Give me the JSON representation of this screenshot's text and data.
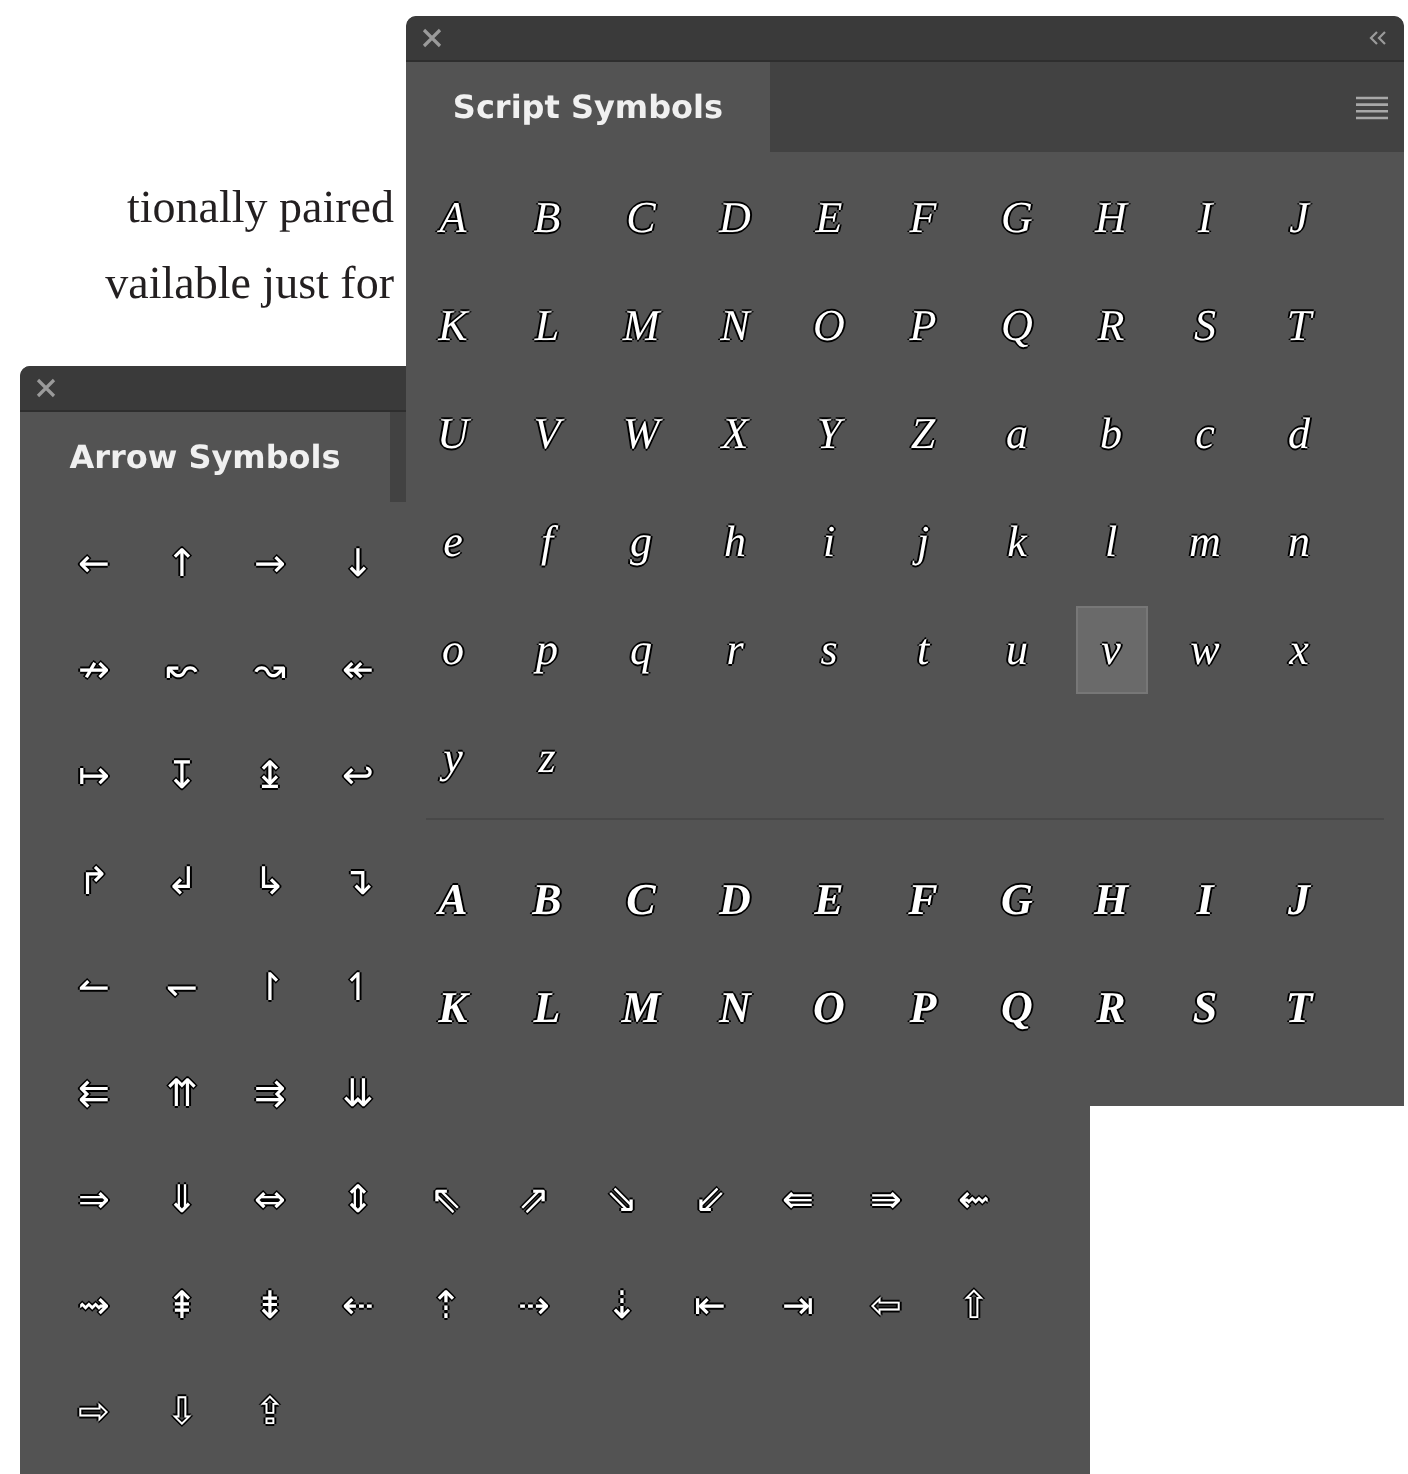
{
  "page_text": [
    "tionally paired",
    "vailable just for"
  ],
  "script_panel": {
    "title": "Script Symbols",
    "sets": [
      {
        "kind": "regular",
        "glyphs": [
          {
            "char": "A",
            "selected": false
          },
          {
            "char": "B",
            "selected": false
          },
          {
            "char": "C",
            "selected": false
          },
          {
            "char": "D",
            "selected": false
          },
          {
            "char": "E",
            "selected": false
          },
          {
            "char": "F",
            "selected": false
          },
          {
            "char": "G",
            "selected": false
          },
          {
            "char": "H",
            "selected": false
          },
          {
            "char": "I",
            "selected": false
          },
          {
            "char": "J",
            "selected": false
          },
          {
            "char": "K",
            "selected": false
          },
          {
            "char": "L",
            "selected": false
          },
          {
            "char": "M",
            "selected": false
          },
          {
            "char": "N",
            "selected": false
          },
          {
            "char": "O",
            "selected": false
          },
          {
            "char": "P",
            "selected": false
          },
          {
            "char": "Q",
            "selected": false
          },
          {
            "char": "R",
            "selected": false
          },
          {
            "char": "S",
            "selected": false
          },
          {
            "char": "T",
            "selected": false
          },
          {
            "char": "U",
            "selected": false
          },
          {
            "char": "V",
            "selected": false
          },
          {
            "char": "W",
            "selected": false
          },
          {
            "char": "X",
            "selected": false
          },
          {
            "char": "Y",
            "selected": false
          },
          {
            "char": "Z",
            "selected": false
          },
          {
            "char": "a",
            "selected": false
          },
          {
            "char": "b",
            "selected": false
          },
          {
            "char": "c",
            "selected": false
          },
          {
            "char": "d",
            "selected": false
          },
          {
            "char": "e",
            "selected": false
          },
          {
            "char": "f",
            "selected": false
          },
          {
            "char": "g",
            "selected": false
          },
          {
            "char": "h",
            "selected": false
          },
          {
            "char": "i",
            "selected": false
          },
          {
            "char": "j",
            "selected": false
          },
          {
            "char": "k",
            "selected": false
          },
          {
            "char": "l",
            "selected": false
          },
          {
            "char": "m",
            "selected": false
          },
          {
            "char": "n",
            "selected": false
          },
          {
            "char": "o",
            "selected": false
          },
          {
            "char": "p",
            "selected": false
          },
          {
            "char": "q",
            "selected": false
          },
          {
            "char": "r",
            "selected": false
          },
          {
            "char": "s",
            "selected": false
          },
          {
            "char": "t",
            "selected": false
          },
          {
            "char": "u",
            "selected": false
          },
          {
            "char": "v",
            "selected": true
          },
          {
            "char": "w",
            "selected": false
          },
          {
            "char": "x",
            "selected": false
          },
          {
            "char": "y",
            "selected": false
          },
          {
            "char": "z",
            "selected": false
          }
        ]
      },
      {
        "kind": "bold",
        "glyphs": [
          {
            "char": "A",
            "selected": false
          },
          {
            "char": "B",
            "selected": false
          },
          {
            "char": "C",
            "selected": false
          },
          {
            "char": "D",
            "selected": false
          },
          {
            "char": "E",
            "selected": false
          },
          {
            "char": "F",
            "selected": false
          },
          {
            "char": "G",
            "selected": false
          },
          {
            "char": "H",
            "selected": false
          },
          {
            "char": "I",
            "selected": false
          },
          {
            "char": "J",
            "selected": false
          },
          {
            "char": "K",
            "selected": false
          },
          {
            "char": "L",
            "selected": false
          },
          {
            "char": "M",
            "selected": false
          },
          {
            "char": "N",
            "selected": false
          },
          {
            "char": "O",
            "selected": false
          },
          {
            "char": "P",
            "selected": false
          },
          {
            "char": "Q",
            "selected": false
          },
          {
            "char": "R",
            "selected": false
          },
          {
            "char": "S",
            "selected": false
          },
          {
            "char": "T",
            "selected": false
          }
        ]
      }
    ]
  },
  "arrow_panel": {
    "title": "Arrow Symbols",
    "rows": [
      [
        {
          "char": "←",
          "selected": false
        },
        {
          "char": "↑",
          "selected": false
        },
        {
          "char": "→",
          "selected": false
        },
        {
          "char": "↓",
          "selected": false
        }
      ],
      [
        {
          "char": "↛",
          "selected": false
        },
        {
          "char": "↜",
          "selected": false
        },
        {
          "char": "↝",
          "selected": false
        },
        {
          "char": "↞",
          "selected": false
        }
      ],
      [
        {
          "char": "↦",
          "selected": false
        },
        {
          "char": "↧",
          "selected": false
        },
        {
          "char": "↨",
          "selected": false
        },
        {
          "char": "↩",
          "selected": false
        }
      ],
      [
        {
          "char": "↱",
          "selected": false
        },
        {
          "char": "↲",
          "selected": false
        },
        {
          "char": "↳",
          "selected": false
        },
        {
          "char": "↴",
          "selected": false
        }
      ],
      [
        {
          "char": "↼",
          "selected": false
        },
        {
          "char": "↽",
          "selected": false
        },
        {
          "char": "↾",
          "selected": false
        },
        {
          "char": "↿",
          "selected": false
        }
      ],
      [
        {
          "char": "⇇",
          "selected": false
        },
        {
          "char": "⇈",
          "selected": false
        },
        {
          "char": "⇉",
          "selected": false
        },
        {
          "char": "⇊",
          "selected": false
        }
      ],
      [
        {
          "char": "⇒",
          "selected": false
        },
        {
          "char": "⇓",
          "selected": false
        },
        {
          "char": "⇔",
          "selected": false
        },
        {
          "char": "⇕",
          "selected": false
        },
        {
          "char": "⇖",
          "selected": false
        },
        {
          "char": "⇗",
          "selected": false
        },
        {
          "char": "⇘",
          "selected": false
        },
        {
          "char": "⇙",
          "selected": false
        },
        {
          "char": "⇚",
          "selected": false
        },
        {
          "char": "⇛",
          "selected": false
        },
        {
          "char": "⇜",
          "selected": false
        }
      ],
      [
        {
          "char": "⇝",
          "selected": false
        },
        {
          "char": "⇞",
          "selected": false
        },
        {
          "char": "⇟",
          "selected": false
        },
        {
          "char": "⇠",
          "selected": false
        },
        {
          "char": "⇡",
          "selected": false
        },
        {
          "char": "⇢",
          "selected": false
        },
        {
          "char": "⇣",
          "selected": false
        },
        {
          "char": "⇤",
          "selected": false
        },
        {
          "char": "⇥",
          "selected": false
        },
        {
          "char": "⇦",
          "selected": false
        },
        {
          "char": "⇧",
          "selected": false
        }
      ],
      [
        {
          "char": "⇨",
          "selected": false
        },
        {
          "char": "⇩",
          "selected": false
        },
        {
          "char": "⇪",
          "selected": false
        }
      ]
    ]
  }
}
